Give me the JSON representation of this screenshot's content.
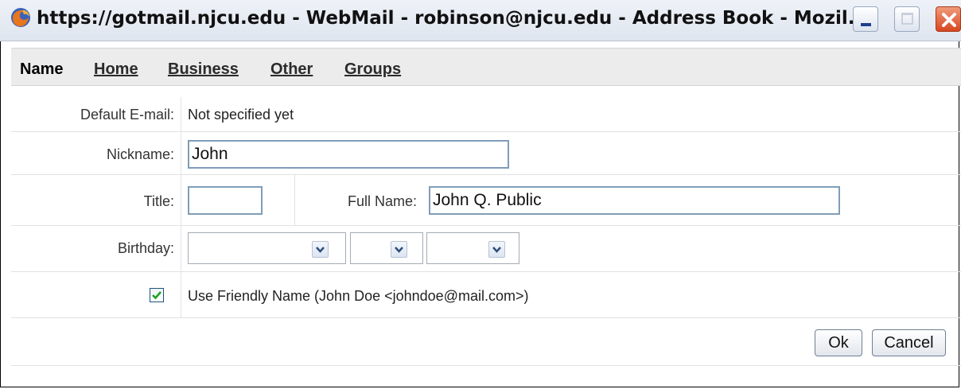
{
  "window": {
    "title": "https://gotmail.njcu.edu - WebMail - robinson@njcu.edu - Address Book - Mozil...",
    "icon": "firefox-icon"
  },
  "tabs": [
    {
      "label": "Name",
      "active": true
    },
    {
      "label": "Home",
      "active": false
    },
    {
      "label": "Business",
      "active": false
    },
    {
      "label": "Other",
      "active": false
    },
    {
      "label": "Groups",
      "active": false
    }
  ],
  "form": {
    "default_email_label": "Default E-mail:",
    "default_email_value": "Not specified yet",
    "nickname_label": "Nickname:",
    "nickname_value": "John",
    "title_label": "Title:",
    "title_value": "",
    "fullname_label": "Full Name:",
    "fullname_value": "John Q. Public",
    "birthday_label": "Birthday:",
    "birthday_month": "",
    "birthday_day": "",
    "birthday_year": "",
    "friendly_name_checked": true,
    "friendly_name_label": "Use Friendly Name (John Doe <johndoe@mail.com>)"
  },
  "buttons": {
    "ok": "Ok",
    "cancel": "Cancel"
  },
  "colors": {
    "input_border": "#7f9db9",
    "checkmark": "#21a121",
    "close_button": "#d8461f"
  }
}
